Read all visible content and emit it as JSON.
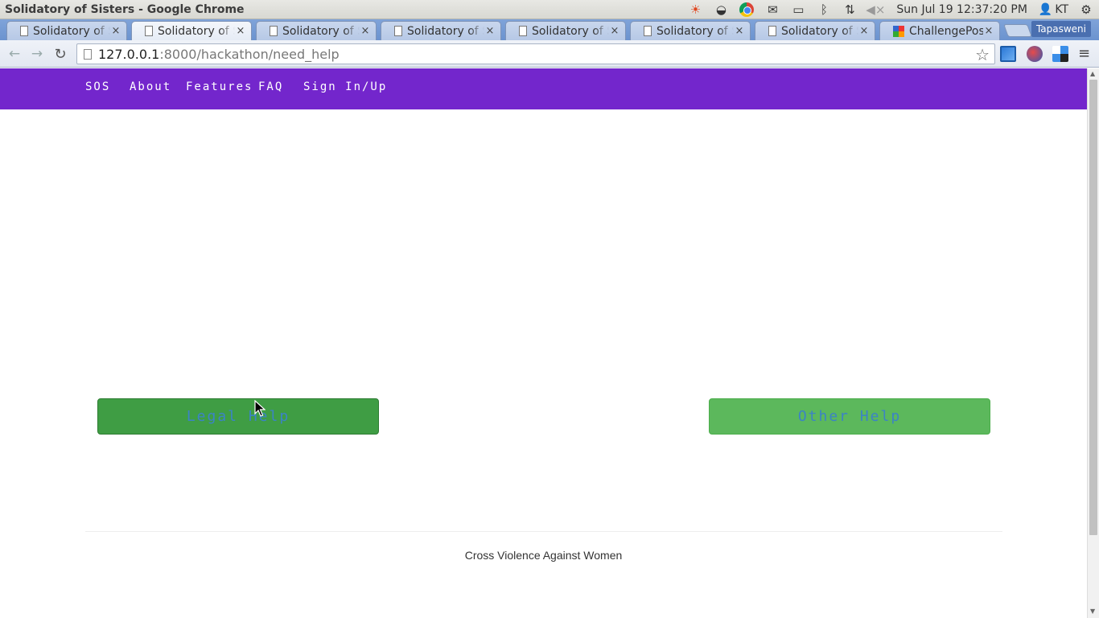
{
  "os_panel": {
    "window_title": "Solidatory of Sisters - Google Chrome",
    "clock": "Sun Jul 19 12:37:20 PM",
    "user": "KT",
    "tray_icons": [
      "sun-icon",
      "network-icon",
      "chrome-icon",
      "mail-icon",
      "battery-icon",
      "bluetooth-icon",
      "transfer-icon",
      "volume-muted-icon",
      "power-gear-icon"
    ]
  },
  "browser": {
    "tabs": [
      {
        "label": "Solidatory of S",
        "active": false
      },
      {
        "label": "Solidatory of S",
        "active": true
      },
      {
        "label": "Solidatory of S",
        "active": false
      },
      {
        "label": "Solidatory of S",
        "active": false
      },
      {
        "label": "Solidatory of S",
        "active": false
      },
      {
        "label": "Solidatory of S",
        "active": false
      },
      {
        "label": "Solidatory of S",
        "active": false
      },
      {
        "label": "ChallengePost",
        "active": false
      }
    ],
    "tab_close_glyph": "×",
    "profile_name": "Tapasweni",
    "url_host": "127.0.0.1",
    "url_rest": ":8000/hackathon/need_help"
  },
  "site": {
    "nav": [
      {
        "label": "SOS"
      },
      {
        "label": "About"
      },
      {
        "label": "Features"
      },
      {
        "label": "FAQ"
      },
      {
        "label": "Sign In/Up"
      }
    ],
    "buttons": {
      "legal_help": "Legal Help",
      "other_help": "Other Help"
    },
    "footer": "Cross Violence Against Women"
  },
  "colors": {
    "nav_background": "#7326cc",
    "legal_button": "#3f9d44",
    "other_button": "#5cb85c",
    "button_text": "#3c83c6"
  }
}
